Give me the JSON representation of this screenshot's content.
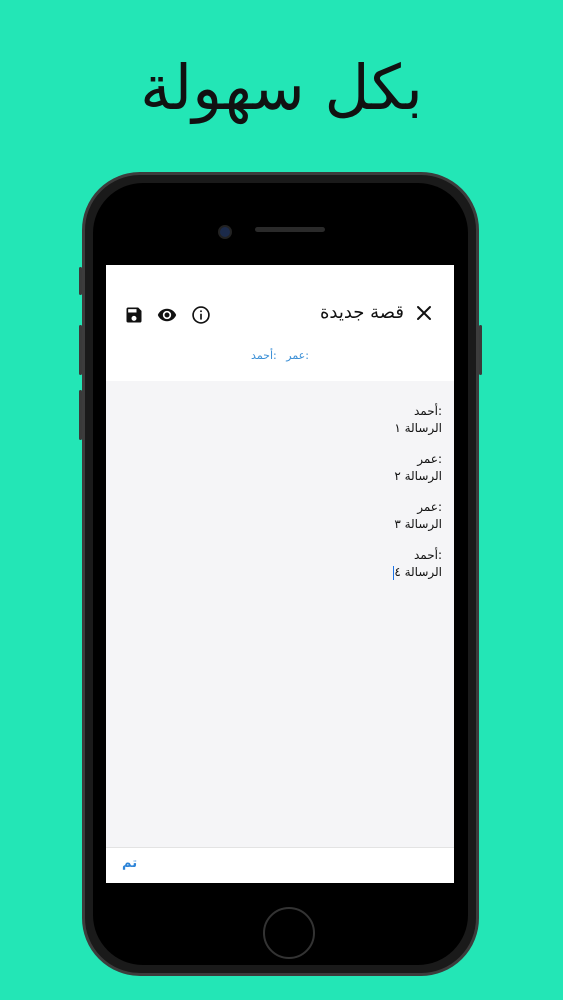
{
  "headline": "بكل سهولة",
  "screen": {
    "title": "قصة جديدة",
    "toolbar": {
      "icons": [
        "save-icon",
        "eye-icon",
        "info-icon",
        "close-icon"
      ]
    },
    "characters": [
      ":عمر",
      ":أحمد"
    ],
    "messages": [
      {
        "speaker": ":أحمد",
        "text": "الرسالة ١"
      },
      {
        "speaker": ":عمر",
        "text": "الرسالة ٢"
      },
      {
        "speaker": ":عمر",
        "text": "الرسالة ٣"
      },
      {
        "speaker": ":أحمد",
        "text": "الرسالة ٤"
      }
    ],
    "done_label": "تم"
  },
  "colors": {
    "background": "#23e6b6",
    "accent": "#2d84d8"
  }
}
